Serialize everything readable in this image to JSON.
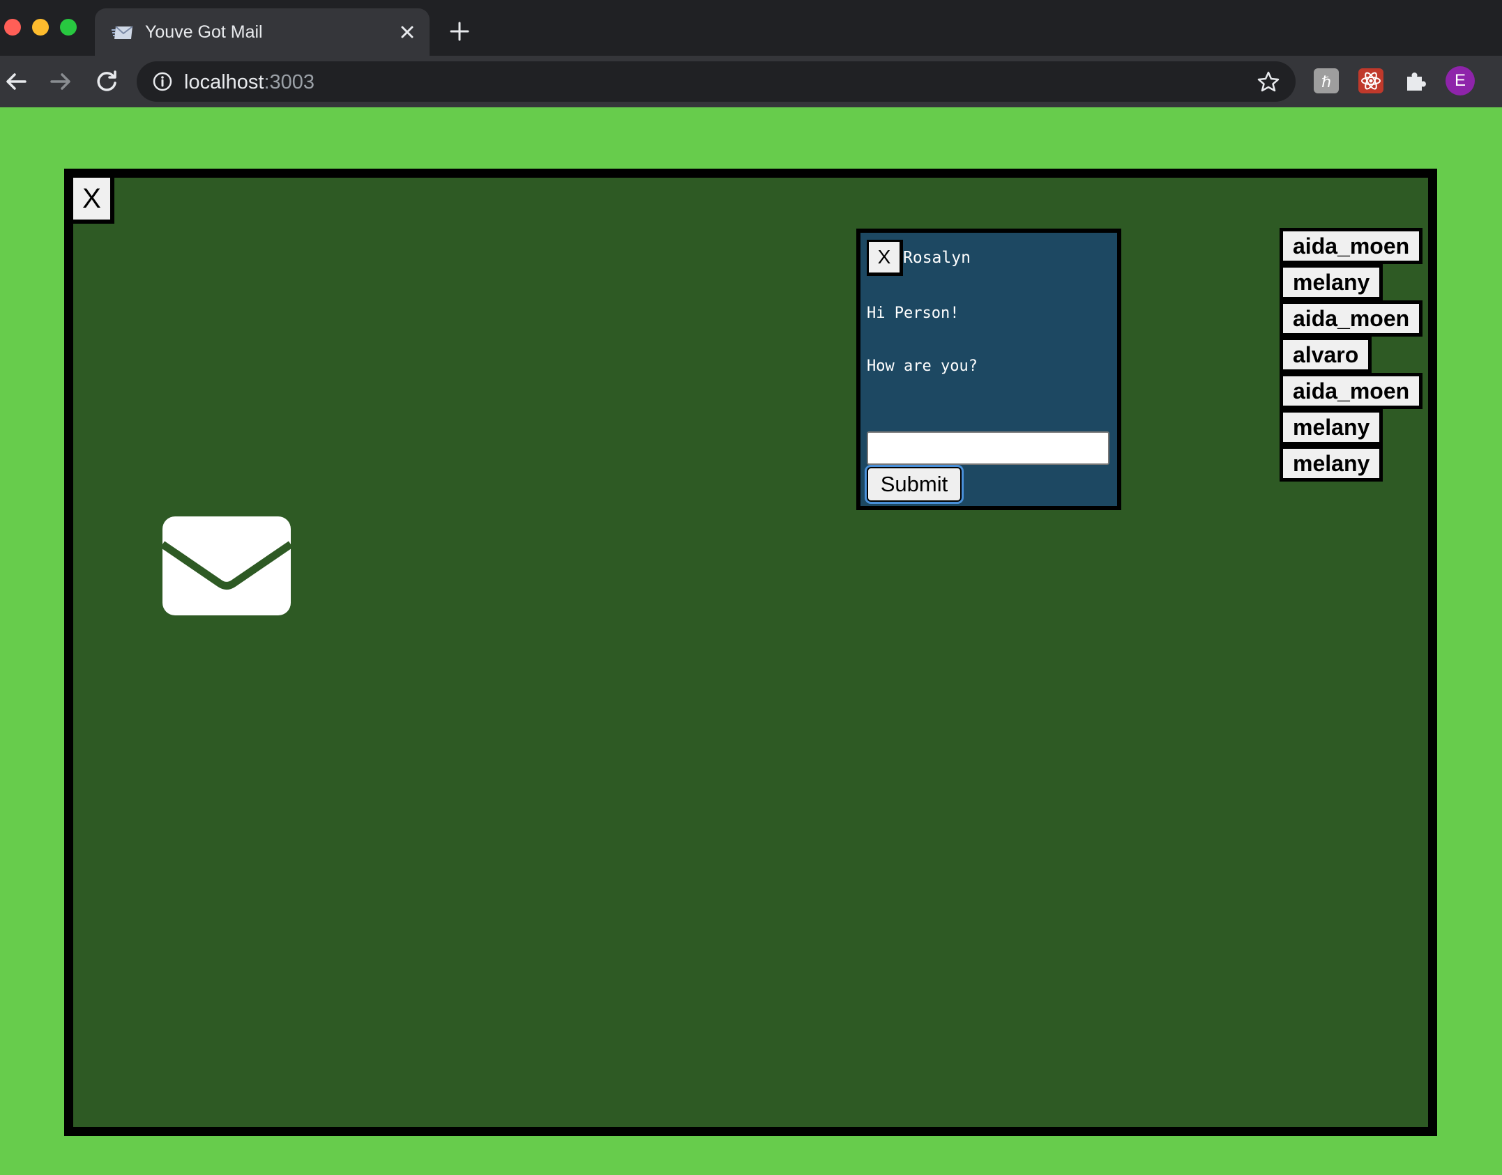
{
  "browser": {
    "tab_title": "Youve Got Mail",
    "url_host": "localhost",
    "url_port": ":3003",
    "profile_initial": "E"
  },
  "app": {
    "frame_close_label": "X",
    "chat": {
      "close_label": "X",
      "recipient": "Rosalyn",
      "messages": [
        "Hi Person!",
        "How are you?"
      ],
      "input_value": "",
      "submit_label": "Submit"
    },
    "users": [
      "aida_moen",
      "melany",
      "aida_moen",
      "alvaro",
      "aida_moen",
      "melany",
      "melany"
    ]
  },
  "colors": {
    "page_bg": "#67cc4c",
    "frame_bg": "#2e5a24",
    "chat_bg": "#1d4862"
  },
  "icons": [
    "mail-icon",
    "close-icon",
    "back-icon",
    "forward-icon",
    "reload-icon",
    "info-icon",
    "star-icon",
    "puzzle-icon"
  ]
}
